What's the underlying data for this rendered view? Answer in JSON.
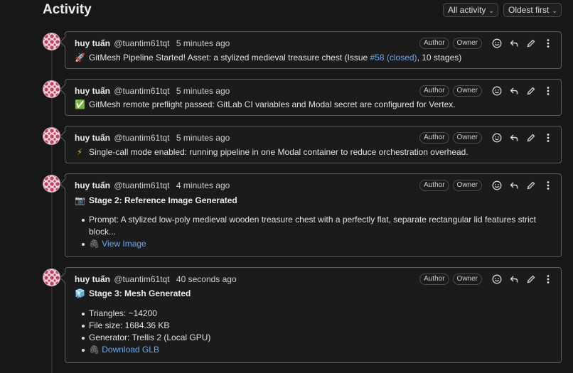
{
  "header": {
    "title": "Activity",
    "filter_label": "All activity",
    "sort_label": "Oldest first"
  },
  "comments": [
    {
      "author": "huy tuấn",
      "handle": "@tuantim61tqt",
      "time": "5 minutes ago",
      "badges": [
        "Author",
        "Owner"
      ],
      "emoji": "🚀",
      "text_before": "GitMesh Pipeline Started! Asset: a stylized medieval treasure chest (Issue ",
      "issue_link": "#58 (closed)",
      "text_after": ", 10 stages)"
    },
    {
      "author": "huy tuấn",
      "handle": "@tuantim61tqt",
      "time": "5 minutes ago",
      "badges": [
        "Author",
        "Owner"
      ],
      "emoji": "✅",
      "text": "GitMesh remote preflight passed: GitLab CI variables and Modal secret are configured for Vertex."
    },
    {
      "author": "huy tuấn",
      "handle": "@tuantim61tqt",
      "time": "5 minutes ago",
      "badges": [
        "Author",
        "Owner"
      ],
      "emoji": "⚡",
      "text": "Single-call mode enabled: running pipeline in one Modal container to reduce orchestration overhead."
    },
    {
      "author": "huy tuấn",
      "handle": "@tuantim61tqt",
      "time": "4 minutes ago",
      "badges": [
        "Author",
        "Owner"
      ],
      "emoji": "📷",
      "heading": "Stage 2: Reference Image Generated",
      "prompt_line1": "Prompt: A stylized low-poly medieval wooden treasure chest with a perfectly flat, separate rectangular lid features strict",
      "prompt_line2": "block...",
      "link": "View Image"
    },
    {
      "author": "huy tuấn",
      "handle": "@tuantim61tqt",
      "time": "40 seconds ago",
      "badges": [
        "Author",
        "Owner"
      ],
      "emoji": "🧊",
      "heading": "Stage 3: Mesh Generated",
      "items": [
        "Triangles: ~14200",
        "File size: 1684.36 KB",
        "Generator: Trellis 2 (Local GPU)"
      ],
      "link": "Download GLB"
    }
  ],
  "colors": {
    "background": "#171717",
    "card_border": "#5d5d5d",
    "link": "#6aa8f2"
  },
  "icons": [
    "emoji-react-icon",
    "reply-icon",
    "edit-icon",
    "more-actions-icon",
    "paperclip-icon",
    "chevron-down-icon"
  ]
}
